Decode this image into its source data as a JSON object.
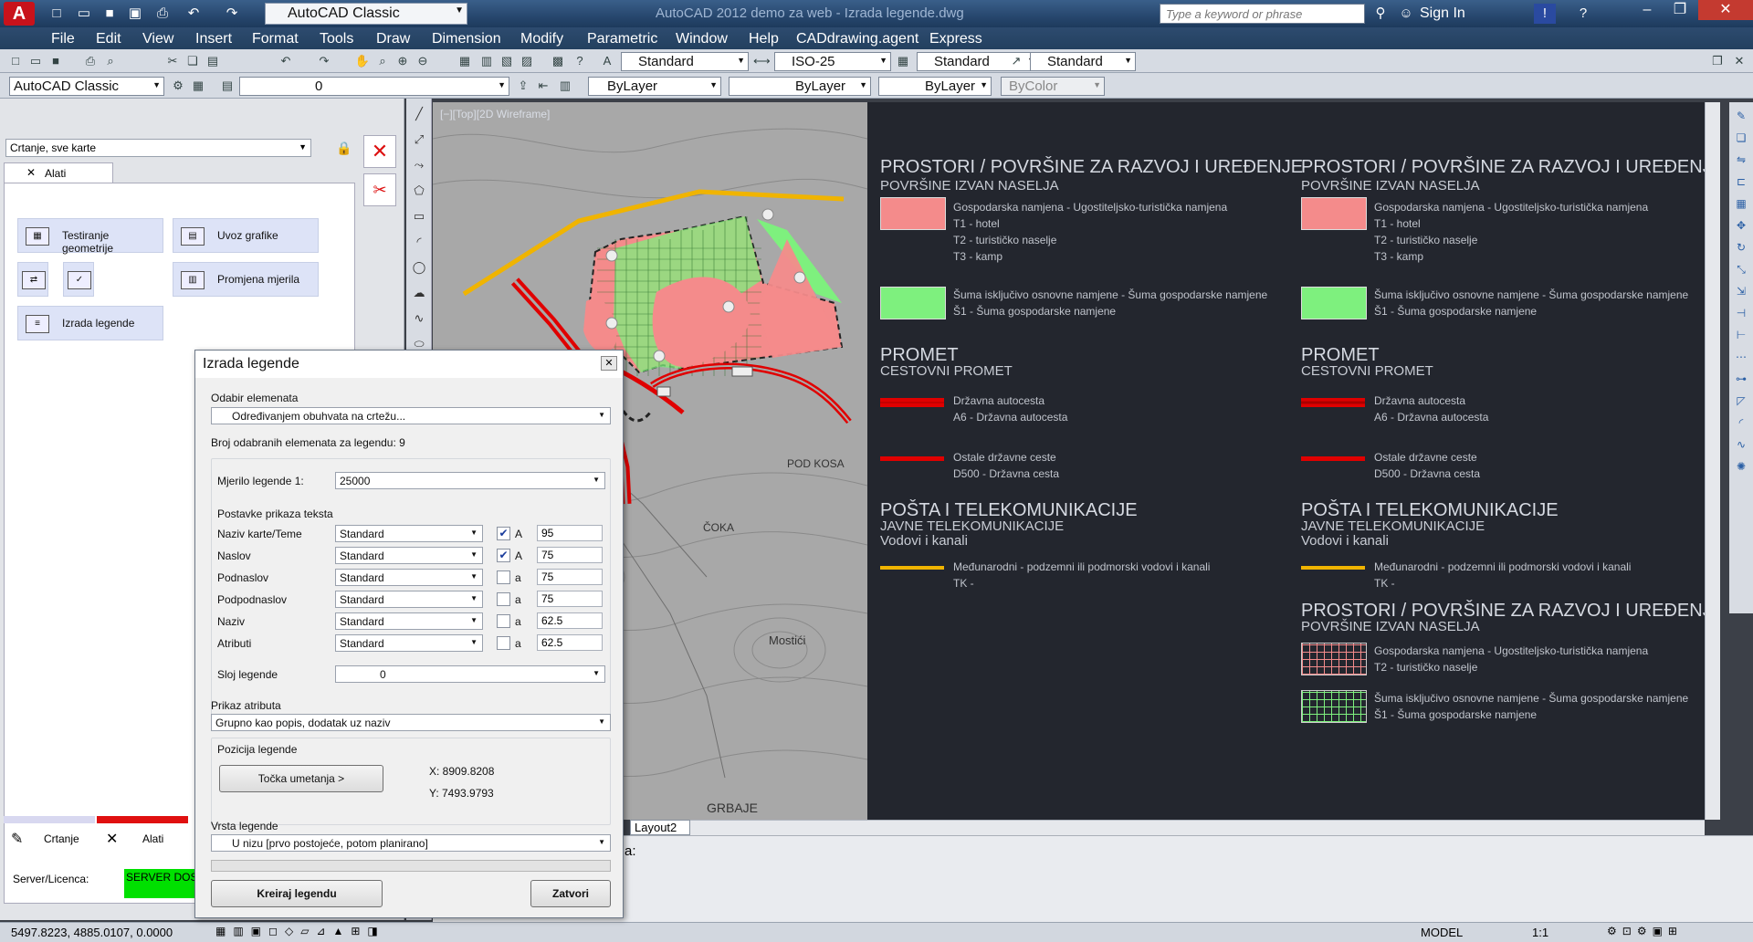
{
  "titlebar": {
    "logo": "A",
    "workspace": "AutoCAD Classic",
    "title": "AutoCAD 2012   demo za web - Izrada legende.dwg",
    "search_placeholder": "Type a keyword or phrase",
    "sign_in": "Sign In"
  },
  "menu": [
    "File",
    "Edit",
    "View",
    "Insert",
    "Format",
    "Tools",
    "Draw",
    "Dimension",
    "Modify",
    "Parametric",
    "Window",
    "Help",
    "CADdrawing.agent",
    "Express"
  ],
  "toolbar": {
    "text_style": "Standard",
    "dim_style": "ISO-25",
    "table_style": "Standard",
    "mleader_style": "Standard",
    "workspace2": "AutoCAD Classic",
    "layer": "0",
    "color": "ByLayer",
    "linetype": "ByLayer",
    "lineweight": "ByLayer",
    "plotstyle": "ByColor"
  },
  "leftpanel": {
    "dropdown": "Crtanje, sve karte",
    "tab": "Alati",
    "tools": [
      {
        "label": "Testiranje geometrije"
      },
      {
        "label": "Uvoz grafike"
      },
      {
        "label": "Promjena mjerila"
      },
      {
        "label": "Izrada legende"
      }
    ],
    "bottom_tabs": [
      "Crtanje",
      "Alati"
    ],
    "server_label": "Server/Licenca:",
    "server_status": "SERVER DOSTU"
  },
  "viewport": {
    "label": "[−][Top][2D Wireframe]",
    "layout_tab": "Layout2",
    "map_labels": [
      "POD KOSA",
      "ČOKA",
      "Mostići",
      "GRBAJE"
    ]
  },
  "legend": {
    "col1": {
      "s1_title": "PROSTORI / POVRŠINE ZA RAZVOJ I UREĐENJE",
      "s1_sub": "POVRŠINE IZVAN NASELJA",
      "s1_items": [
        "Gospodarska namjena - Ugostiteljsko-turistička namjena",
        "T1 - hotel",
        "T2 - turističko naselje",
        "T3 - kamp"
      ],
      "s1_items2": [
        "Šuma isključivo osnovne namjene - Šuma gospodarske namjene",
        "Š1 - Šuma gospodarske namjene"
      ],
      "s2_title": "PROMET",
      "s2_sub": "CESTOVNI PROMET",
      "s2_items": [
        "Državna autocesta",
        "A6 - Državna autocesta"
      ],
      "s2_items2": [
        "Ostale državne ceste",
        "D500 - Državna cesta"
      ],
      "s3_title": "POŠTA I TELEKOMUNIKACIJE",
      "s3_sub": "JAVNE TELEKOMUNIKACIJE",
      "s3_sub2": "Vodovi i kanali",
      "s3_items": [
        "Međunarodni - podzemni ili podmorski vodovi i kanali",
        "TK -"
      ]
    },
    "col2": {
      "s1_title": "PROSTORI / POVRŠINE ZA RAZVOJ I UREĐENJE",
      "s1_sub": "POVRŠINE IZVAN NASELJA",
      "s1_items": [
        "Gospodarska namjena - Ugostiteljsko-turistička namjena",
        "T1 - hotel",
        "T2 - turističko naselje",
        "T3 - kamp"
      ],
      "s1_items2": [
        "Šuma isključivo osnovne namjene - Šuma gospodarske namjene",
        "Š1 - Šuma gospodarske namjene"
      ],
      "s2_title": "PROMET",
      "s2_sub": "CESTOVNI PROMET",
      "s2_items": [
        "Državna autocesta",
        "A6 - Državna autocesta"
      ],
      "s2_items2": [
        "Ostale državne ceste",
        "D500 - Državna cesta"
      ],
      "s3_title": "POŠTA I TELEKOMUNIKACIJE",
      "s3_sub": "JAVNE TELEKOMUNIKACIJE",
      "s3_sub2": "Vodovi i kanali",
      "s3_items": [
        "Međunarodni - podzemni ili podmorski vodovi i kanali",
        "TK -"
      ],
      "s4_title": "PROSTORI / POVRŠINE ZA RAZVOJ I UREĐENJE",
      "s4_sub": "POVRŠINE IZVAN NASELJA",
      "s4_items": [
        "Gospodarska namjena - Ugostiteljsko-turistička namjena",
        "T2 - turističko naselje"
      ],
      "s4_items2": [
        "Šuma isključivo osnovne namjene - Šuma gospodarske namjene",
        "Š1 - Šuma gospodarske namjene"
      ]
    }
  },
  "dialog": {
    "title": "Izrada legende",
    "sel_label": "Odabir elemenata",
    "sel_value": "Određivanjem obuhvata na crtežu...",
    "count_label": "Broj odabranih elemenata za legendu: 9",
    "scale_label": "Mjerilo legende 1:",
    "scale_value": "25000",
    "text_group": "Postavke prikaza teksta",
    "rows": [
      {
        "name": "Naziv karte/Teme",
        "style": "Standard",
        "checked": "✔",
        "case": "A",
        "size": "95"
      },
      {
        "name": "Naslov",
        "style": "Standard",
        "checked": "✔",
        "case": "A",
        "size": "75"
      },
      {
        "name": "Podnaslov",
        "style": "Standard",
        "checked": "",
        "case": "a",
        "size": "75"
      },
      {
        "name": "Podpodnaslov",
        "style": "Standard",
        "checked": "",
        "case": "a",
        "size": "75"
      },
      {
        "name": "Naziv",
        "style": "Standard",
        "checked": "",
        "case": "a",
        "size": "62.5"
      },
      {
        "name": "Atributi",
        "style": "Standard",
        "checked": "",
        "case": "a",
        "size": "62.5"
      }
    ],
    "layer_label": "Sloj legende",
    "layer_value": "0",
    "attr_label": "Prikaz atributa",
    "attr_value": "Grupno kao popis, dodatak uz naziv",
    "pos_label": "Pozicija legende",
    "insert_btn": "Točka umetanja >",
    "x": "X: 8909.8208",
    "y": "Y: 7493.9793",
    "type_label": "Vrsta legende",
    "type_value": "U nizu [prvo postojeće, potom planirano]",
    "create_btn": "Kreiraj legendu",
    "close_btn": "Zatvori"
  },
  "cmdline": {
    "text": "a:"
  },
  "statusbar": {
    "coords": "5497.8223,  4885.0107, 0.0000",
    "model": "MODEL",
    "scale": "1:1"
  },
  "colors": {
    "accent": "#c8121b",
    "pink": "#f48b8b",
    "green": "#7ef07e",
    "road_red": "#e00000",
    "telecom": "#f0b400"
  }
}
